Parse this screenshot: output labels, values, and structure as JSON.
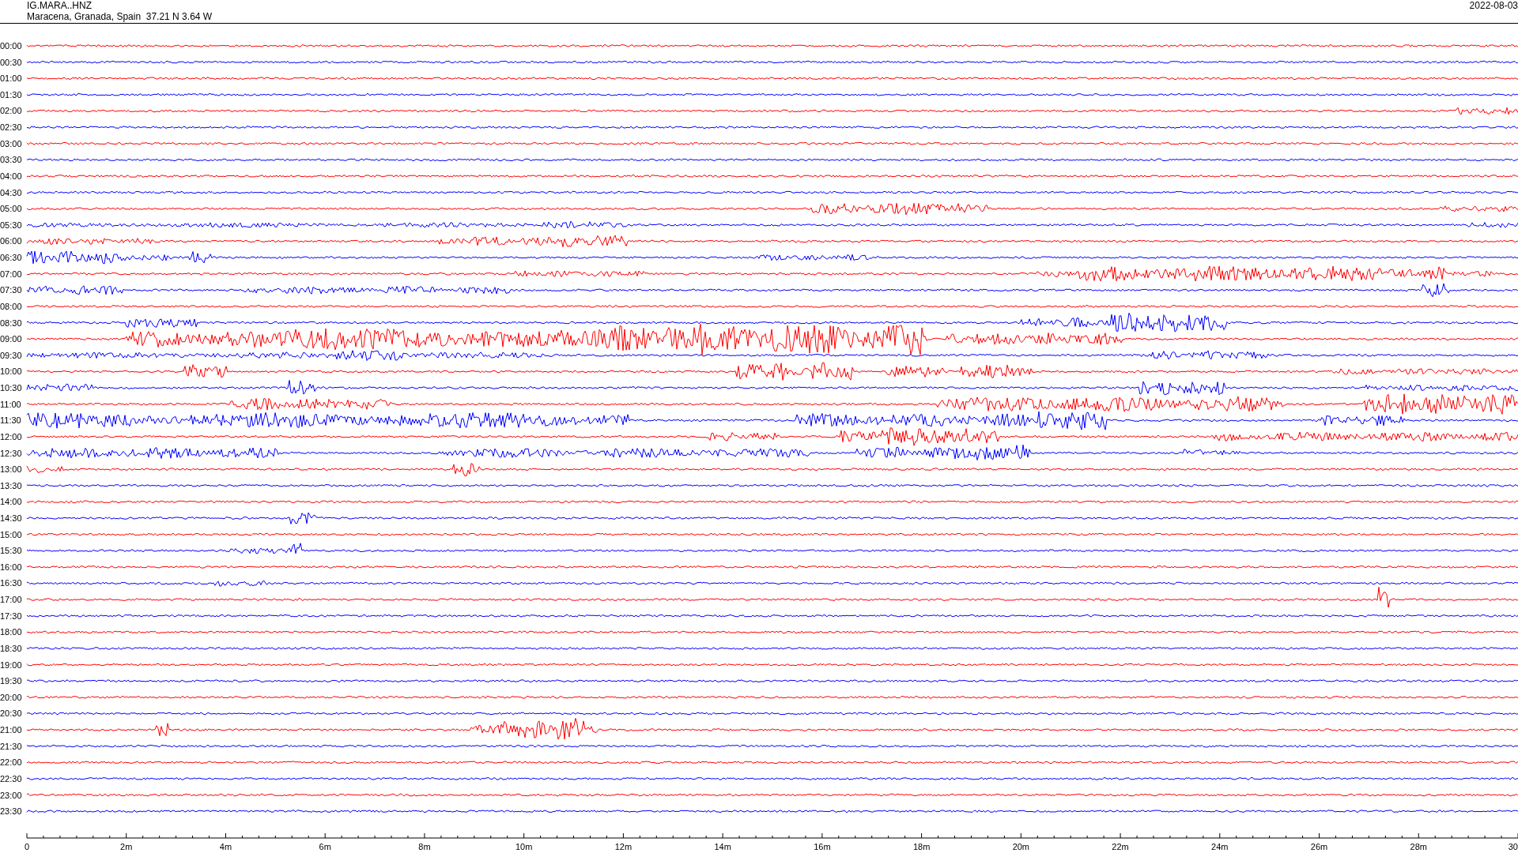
{
  "header": {
    "station": "IG.MARA..HNZ",
    "location": "Maracena, Granada, Spain  37.21 N 3.64 W",
    "date": "2022-08-03"
  },
  "rows": [
    {
      "time": "00:00",
      "color": "#ff0000"
    },
    {
      "time": "00:30",
      "color": "#0000ff"
    },
    {
      "time": "01:00",
      "color": "#ff0000"
    },
    {
      "time": "01:30",
      "color": "#0000ff"
    },
    {
      "time": "02:00",
      "color": "#ff0000"
    },
    {
      "time": "02:30",
      "color": "#0000ff"
    },
    {
      "time": "03:00",
      "color": "#ff0000"
    },
    {
      "time": "03:30",
      "color": "#0000ff"
    },
    {
      "time": "04:00",
      "color": "#ff0000"
    },
    {
      "time": "04:30",
      "color": "#0000ff"
    },
    {
      "time": "05:00",
      "color": "#ff0000"
    },
    {
      "time": "05:30",
      "color": "#0000ff"
    },
    {
      "time": "06:00",
      "color": "#ff0000"
    },
    {
      "time": "06:30",
      "color": "#0000ff"
    },
    {
      "time": "07:00",
      "color": "#ff0000"
    },
    {
      "time": "07:30",
      "color": "#0000ff"
    },
    {
      "time": "08:00",
      "color": "#ff0000"
    },
    {
      "time": "08:30",
      "color": "#0000ff"
    },
    {
      "time": "09:00",
      "color": "#ff0000"
    },
    {
      "time": "09:30",
      "color": "#0000ff"
    },
    {
      "time": "10:00",
      "color": "#ff0000"
    },
    {
      "time": "10:30",
      "color": "#0000ff"
    },
    {
      "time": "11:00",
      "color": "#ff0000"
    },
    {
      "time": "11:30",
      "color": "#0000ff"
    },
    {
      "time": "12:00",
      "color": "#ff0000"
    },
    {
      "time": "12:30",
      "color": "#0000ff"
    },
    {
      "time": "13:00",
      "color": "#ff0000"
    },
    {
      "time": "13:30",
      "color": "#0000ff"
    },
    {
      "time": "14:00",
      "color": "#ff0000"
    },
    {
      "time": "14:30",
      "color": "#0000ff"
    },
    {
      "time": "15:00",
      "color": "#ff0000"
    },
    {
      "time": "15:30",
      "color": "#0000ff"
    },
    {
      "time": "16:00",
      "color": "#ff0000"
    },
    {
      "time": "16:30",
      "color": "#0000ff"
    },
    {
      "time": "17:00",
      "color": "#ff0000"
    },
    {
      "time": "17:30",
      "color": "#0000ff"
    },
    {
      "time": "18:00",
      "color": "#ff0000"
    },
    {
      "time": "18:30",
      "color": "#0000ff"
    },
    {
      "time": "19:00",
      "color": "#ff0000"
    },
    {
      "time": "19:30",
      "color": "#0000ff"
    },
    {
      "time": "20:00",
      "color": "#ff0000"
    },
    {
      "time": "20:30",
      "color": "#0000ff"
    },
    {
      "time": "21:00",
      "color": "#ff0000"
    },
    {
      "time": "21:30",
      "color": "#0000ff"
    },
    {
      "time": "22:00",
      "color": "#ff0000"
    },
    {
      "time": "22:30",
      "color": "#0000ff"
    },
    {
      "time": "23:00",
      "color": "#ff0000"
    },
    {
      "time": "23:30",
      "color": "#0000ff"
    }
  ],
  "x_axis": {
    "labels": [
      "0",
      "2m",
      "4m",
      "6m",
      "8m",
      "10m",
      "12m",
      "14m",
      "16m",
      "18m",
      "20m",
      "22m",
      "24m",
      "26m",
      "28m",
      "30"
    ]
  }
}
